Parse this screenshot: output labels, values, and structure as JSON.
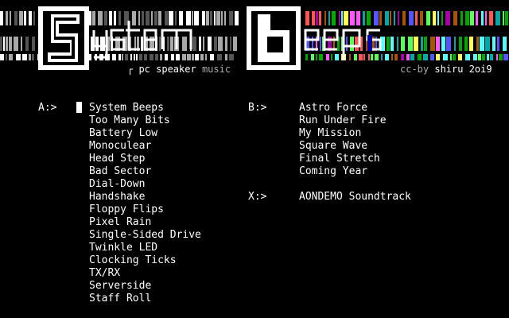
{
  "logo": {
    "title_text": "SystemBeeps"
  },
  "subtitle": {
    "left_prefix": "pc speaker",
    "left_suffix": "music",
    "right_prefix": "cc-by",
    "right_suffix": "shiru 2oi9"
  },
  "drive_a": {
    "prompt": "A:>",
    "tracks": [
      "System Beeps",
      "Too Many Bits",
      "Battery Low",
      "Monoculear",
      "Head Step",
      "Bad Sector",
      "Dial-Down",
      "Handshake",
      "Floppy Flips",
      "Pixel Rain",
      "Single-Sided Drive",
      "Twinkle LED",
      "Clocking Ticks",
      "TX/RX",
      "Serverside",
      "Staff Roll"
    ]
  },
  "drive_b": {
    "prompt": "B:>",
    "tracks": [
      "Astro Force",
      "Run Under Fire",
      "My Mission",
      "Square Wave",
      "Final Stretch",
      "Coming Year"
    ]
  },
  "drive_x": {
    "prompt": "X:>",
    "tracks": [
      "AONDEMO Soundtrack"
    ]
  },
  "selected_track": "System Beeps",
  "colors": {
    "background": "#000000",
    "text": "#ffffff",
    "dim_text": "#a8a8a8",
    "rainbow": [
      "#00a800",
      "#55ff55",
      "#00a8a8",
      "#5555ff",
      "#a800a8",
      "#ff55ff",
      "#a85400",
      "#ffff55",
      "#ff5555",
      "#55ffff"
    ]
  }
}
